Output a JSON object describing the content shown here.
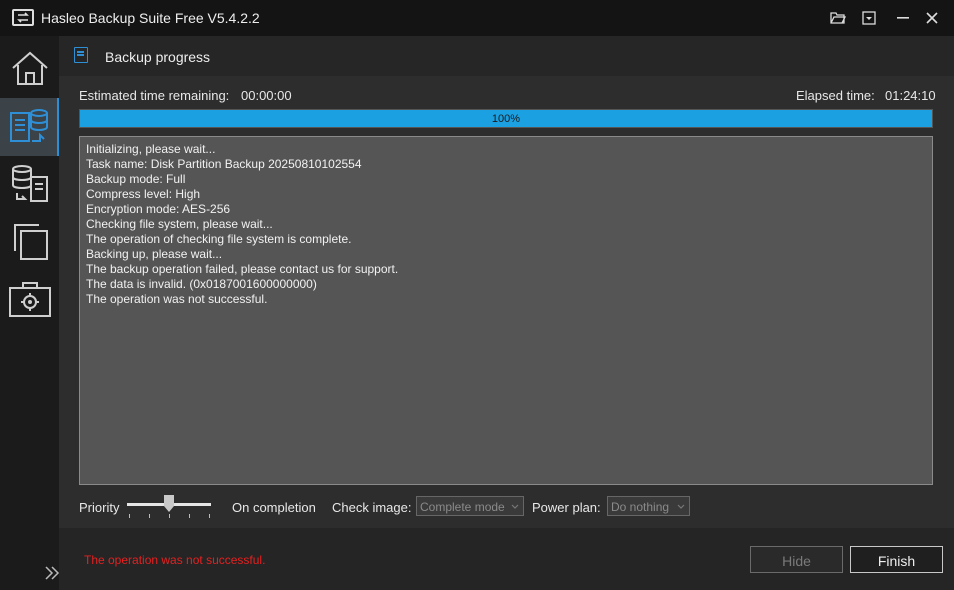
{
  "window": {
    "title": "Hasleo Backup Suite Free V5.4.2.2"
  },
  "sidebar": {
    "items": [
      {
        "icon": "home-icon"
      },
      {
        "icon": "backup-icon",
        "active": true
      },
      {
        "icon": "restore-icon"
      },
      {
        "icon": "clone-icon"
      },
      {
        "icon": "tools-icon"
      }
    ]
  },
  "header": {
    "title": "Backup progress"
  },
  "progress": {
    "estimated_label": "Estimated time remaining:",
    "estimated_value": "00:00:00",
    "elapsed_label": "Elapsed time:",
    "elapsed_value": "01:24:10",
    "percent_text": "100%",
    "percent": 100
  },
  "log": [
    "Initializing, please wait...",
    "Task name: Disk Partition Backup 20250810102554",
    "Backup mode: Full",
    "Compress level: High",
    "Encryption mode: AES-256",
    "Checking file system, please wait...",
    "The operation of checking file system is complete.",
    "Backing up, please wait...",
    "The backup operation failed, please contact us for support.",
    "The data is invalid. (0x0187001600000000)",
    "The operation was not successful."
  ],
  "controls": {
    "priority_label": "Priority",
    "on_completion_label": "On completion",
    "check_image_label": "Check image:",
    "check_image_value": "Complete mode",
    "power_plan_label": "Power plan:",
    "power_plan_value": "Do nothing"
  },
  "footer": {
    "status": "The operation was not successful.",
    "hide_label": "Hide",
    "finish_label": "Finish"
  },
  "colors": {
    "accent": "#1ba0e2",
    "error": "#e62020"
  }
}
